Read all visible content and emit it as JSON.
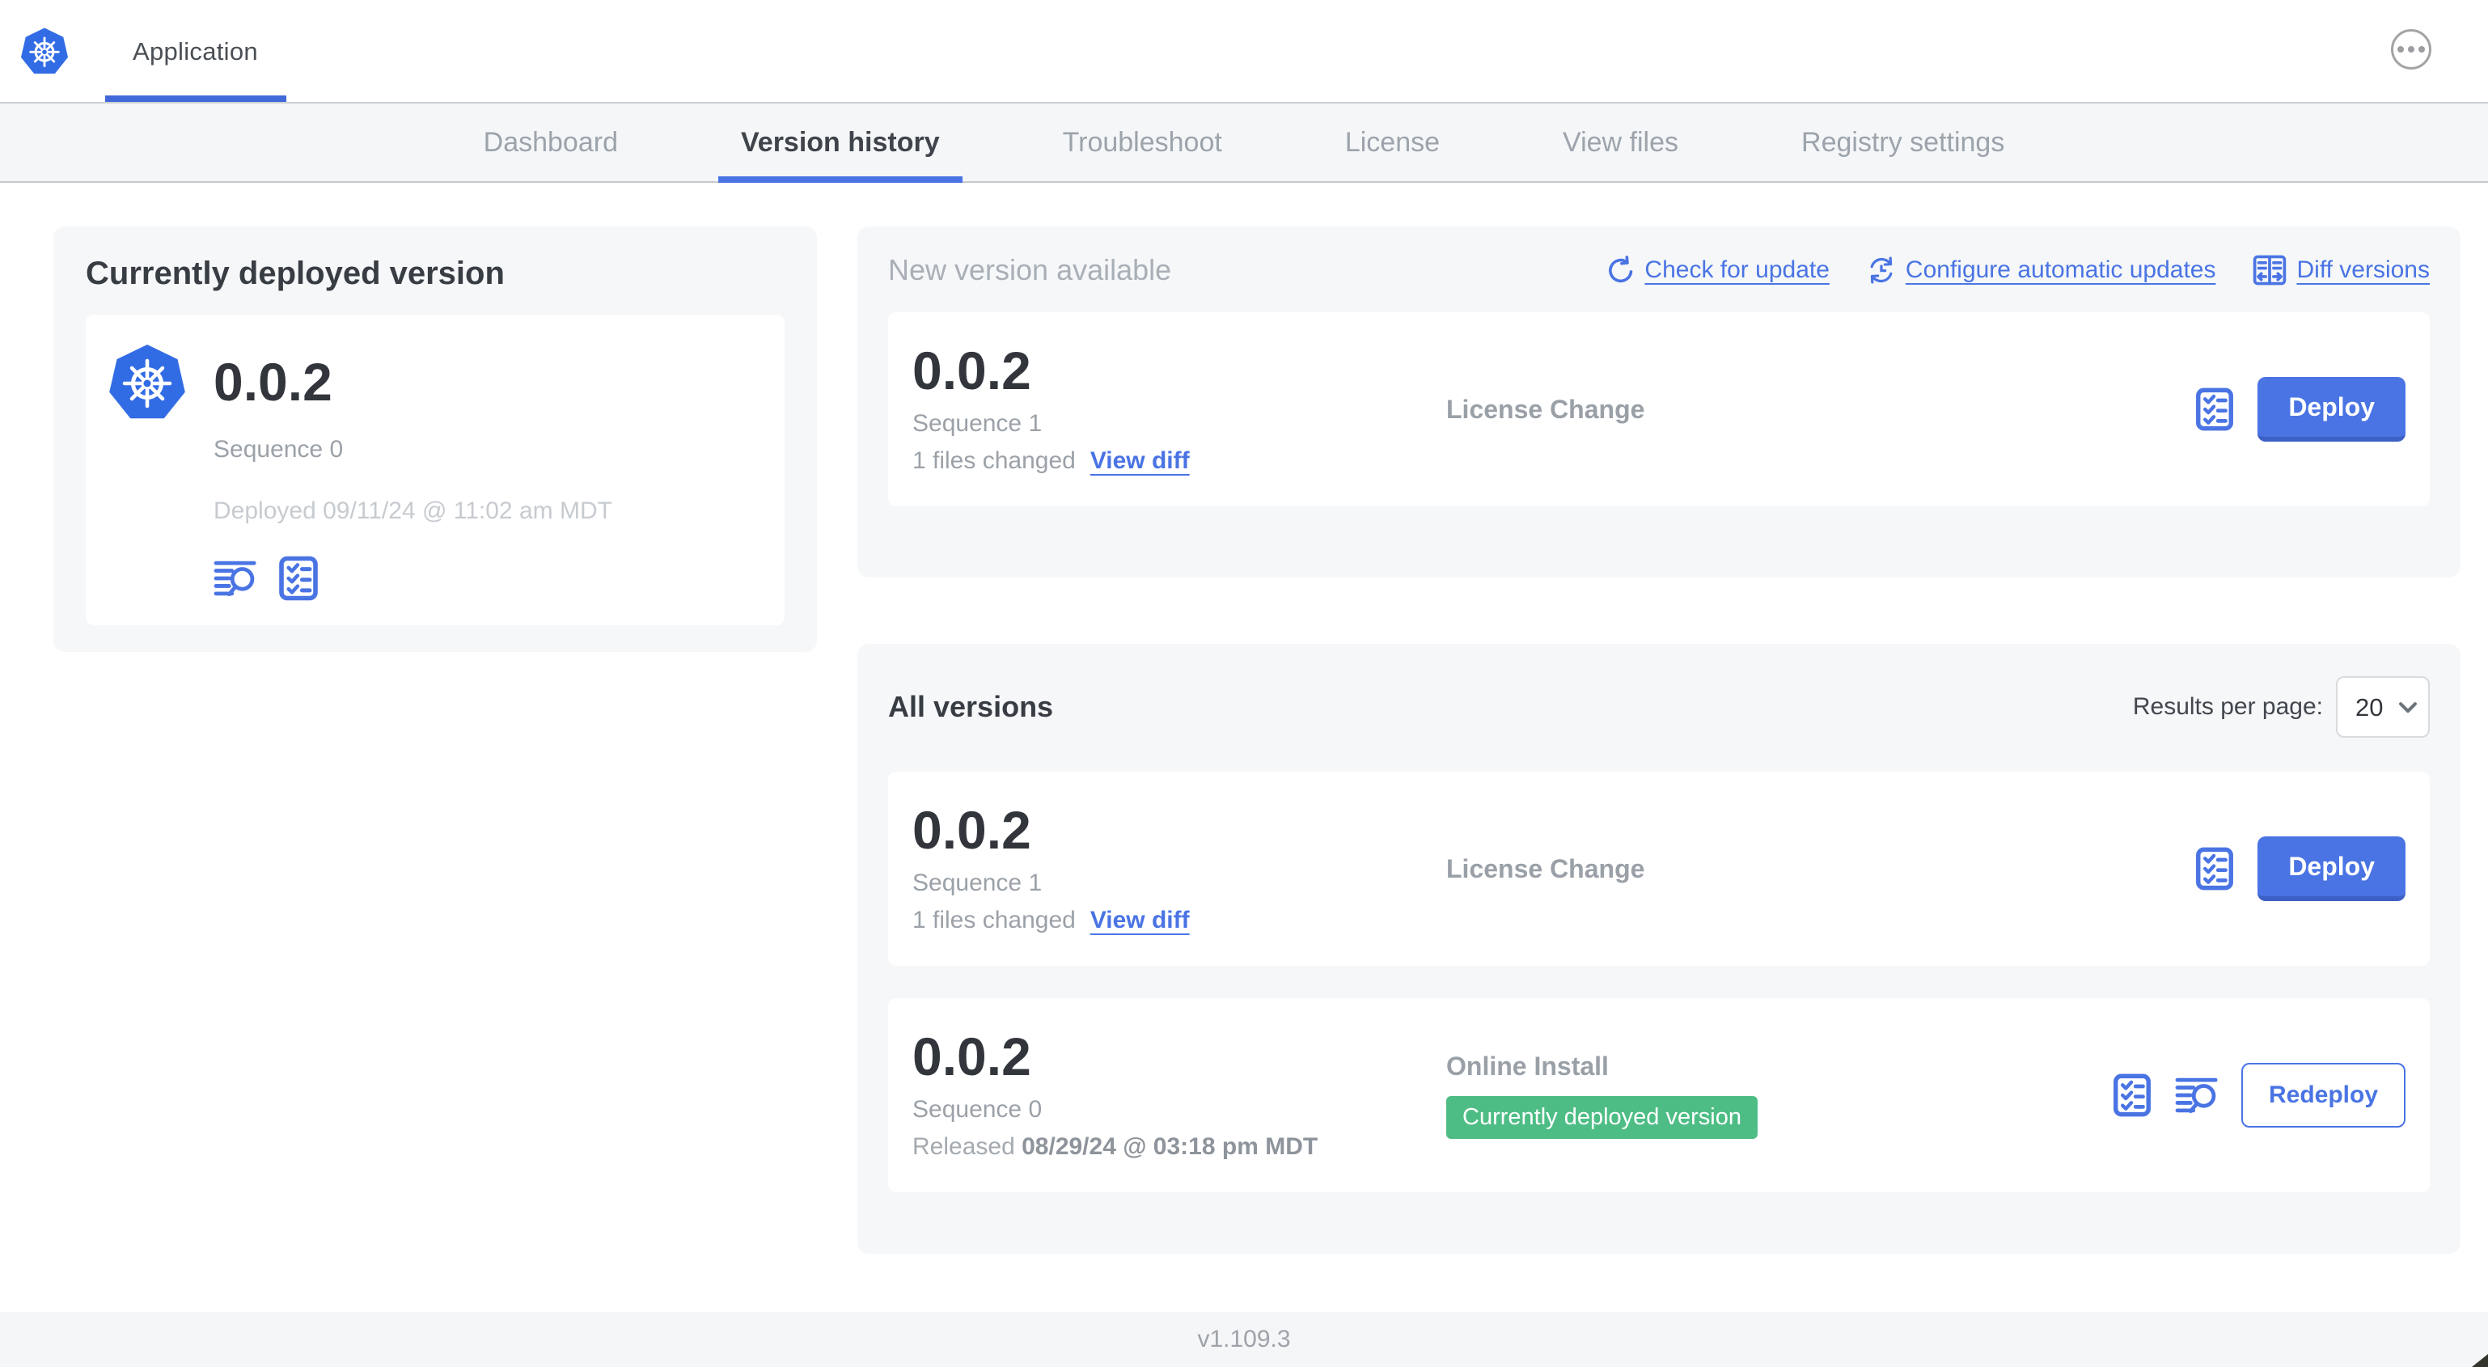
{
  "header": {
    "title": "Application"
  },
  "nav": {
    "tabs": [
      {
        "label": "Dashboard",
        "active": false
      },
      {
        "label": "Version history",
        "active": true
      },
      {
        "label": "Troubleshoot",
        "active": false
      },
      {
        "label": "License",
        "active": false
      },
      {
        "label": "View files",
        "active": false
      },
      {
        "label": "Registry settings",
        "active": false
      }
    ]
  },
  "current": {
    "title": "Currently deployed version",
    "version": "0.0.2",
    "sequence": "Sequence 0",
    "deployed": "Deployed 09/11/24 @ 11:02 am MDT"
  },
  "newver": {
    "heading": "New version available",
    "links": {
      "check": "Check for update",
      "configure": "Configure automatic updates",
      "diff": "Diff versions"
    },
    "row": {
      "version": "0.0.2",
      "sequence": "Sequence 1",
      "files": "1 files changed",
      "view_diff": "View diff",
      "source": "License Change",
      "action": "Deploy"
    }
  },
  "all": {
    "title": "All versions",
    "rpp_label": "Results per page:",
    "rpp_value": "20",
    "rows": [
      {
        "version": "0.0.2",
        "sequence": "Sequence 1",
        "files": "1 files changed",
        "view_diff": "View diff",
        "source": "License Change",
        "action": "Deploy"
      },
      {
        "version": "0.0.2",
        "sequence": "Sequence 0",
        "released_label": "Released",
        "released_value": "08/29/24 @ 03:18 pm MDT",
        "source": "Online Install",
        "badge": "Currently deployed version",
        "action": "Redeploy"
      }
    ]
  },
  "footer": {
    "version": "v1.109.3"
  },
  "colors": {
    "accent": "#4A74E4",
    "k8s_blue": "#326CE5",
    "badge_green": "#4EBD85",
    "section_bg": "#F5F7F9",
    "muted_text": "#9BA1A8"
  }
}
